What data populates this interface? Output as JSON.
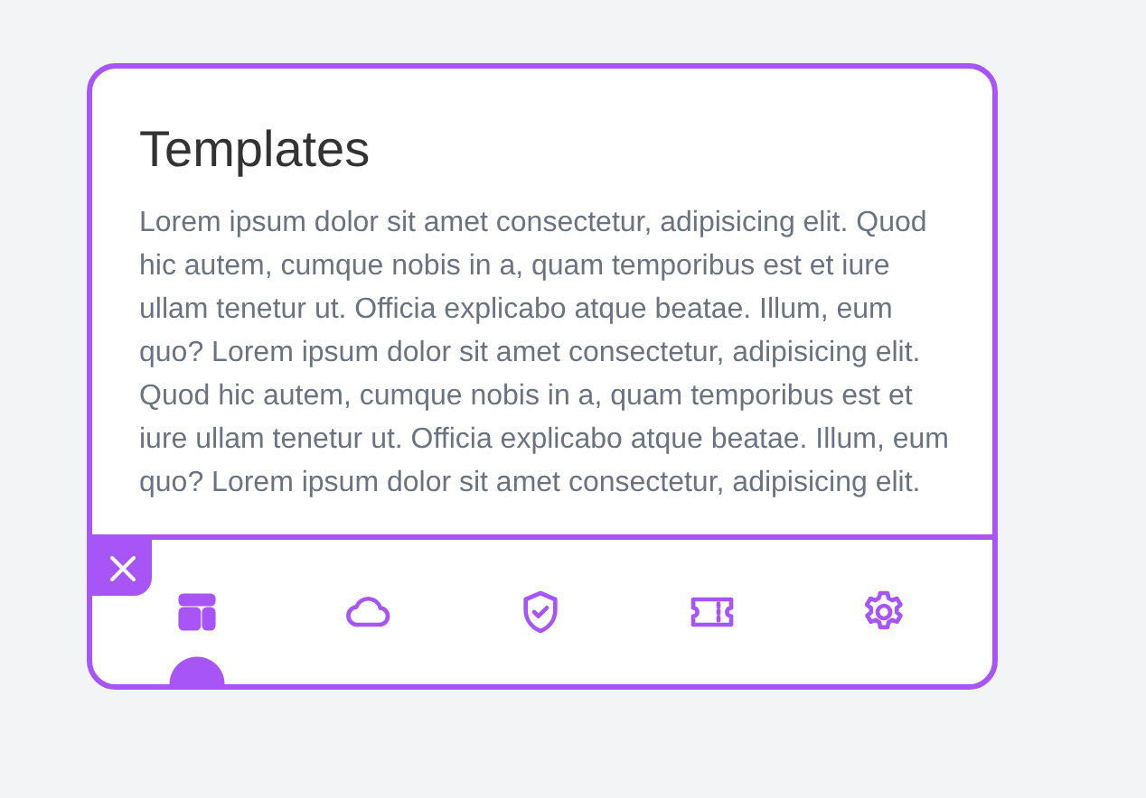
{
  "card": {
    "title": "Templates",
    "body": "Lorem ipsum dolor sit amet consectetur, adipisicing elit. Quod hic autem, cumque nobis in a, quam temporibus est et iure ullam tenetur ut. Officia explicabo atque beatae. Illum, eum quo? Lorem ipsum dolor sit amet consectetur, adipisicing elit. Quod hic autem, cumque nobis in a, quam temporibus est et iure ullam tenetur ut. Officia explicabo atque beatae. Illum, eum quo? Lorem ipsum dolor sit amet consectetur, adipisicing elit."
  },
  "tabs": [
    {
      "kind": "layout",
      "selected": true
    },
    {
      "kind": "cloud",
      "selected": false
    },
    {
      "kind": "shield",
      "selected": false
    },
    {
      "kind": "ticket",
      "selected": false
    },
    {
      "kind": "gear",
      "selected": false
    }
  ]
}
